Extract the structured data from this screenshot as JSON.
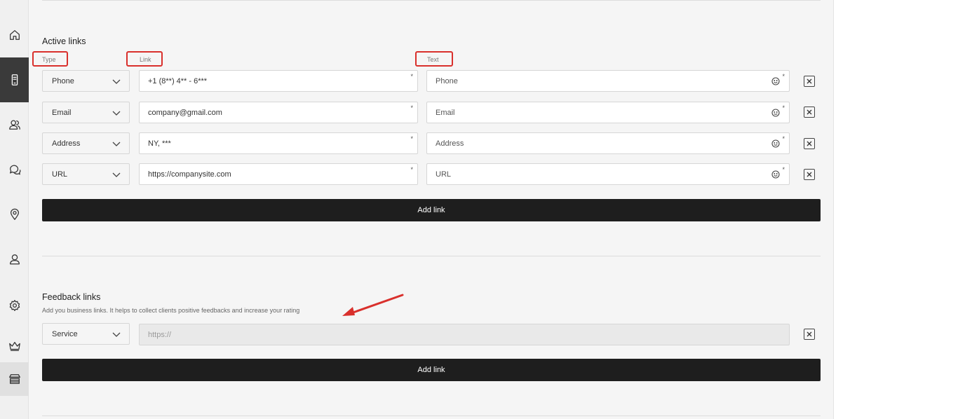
{
  "sidebar": {
    "items": [
      {
        "icon": "home-icon"
      },
      {
        "icon": "mobile-icon"
      },
      {
        "icon": "users-icon"
      },
      {
        "icon": "chat-icon"
      },
      {
        "icon": "location-icon"
      },
      {
        "icon": "user-icon"
      },
      {
        "icon": "settings-icon"
      },
      {
        "icon": "crown-icon"
      },
      {
        "icon": "store-icon"
      }
    ]
  },
  "active_links": {
    "title": "Active links",
    "labels": {
      "type": "Type",
      "link": "Link",
      "text": "Text"
    },
    "rows": [
      {
        "type": "Phone",
        "link": "+1 (8**) 4** - 6***",
        "text_placeholder": "Phone",
        "required": "*"
      },
      {
        "type": "Email",
        "link": "company@gmail.com",
        "text_placeholder": "Email",
        "required": "*"
      },
      {
        "type": "Address",
        "link": "NY, ***",
        "text_placeholder": "Address",
        "required": "*"
      },
      {
        "type": "URL",
        "link": "https://companysite.com",
        "text_placeholder": "URL",
        "required": "*"
      }
    ],
    "add_button": "Add link"
  },
  "feedback_links": {
    "title": "Feedback links",
    "subtitle": "Add you business links. It helps to collect clients positive feedbacks and increase your rating",
    "rows": [
      {
        "type": "Service",
        "link_placeholder": "https://"
      }
    ],
    "add_button": "Add link"
  },
  "colors": {
    "annotation": "#d9302c",
    "button_bg": "#1e1e1e",
    "panel_bg": "#f5f5f5"
  }
}
